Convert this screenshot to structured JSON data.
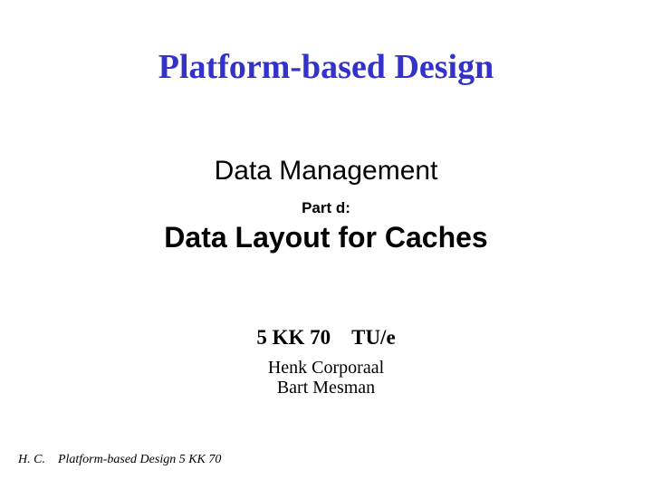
{
  "slide": {
    "title": "Platform-based Design",
    "subtitle1": "Data Management",
    "part": "Part d:",
    "subtitle2": "Data Layout for Caches",
    "course": "5 KK 70 TU/e",
    "author1": "Henk Corporaal",
    "author2": "Bart Mesman",
    "footer": "H. C. Platform-based Design 5 KK 70"
  }
}
